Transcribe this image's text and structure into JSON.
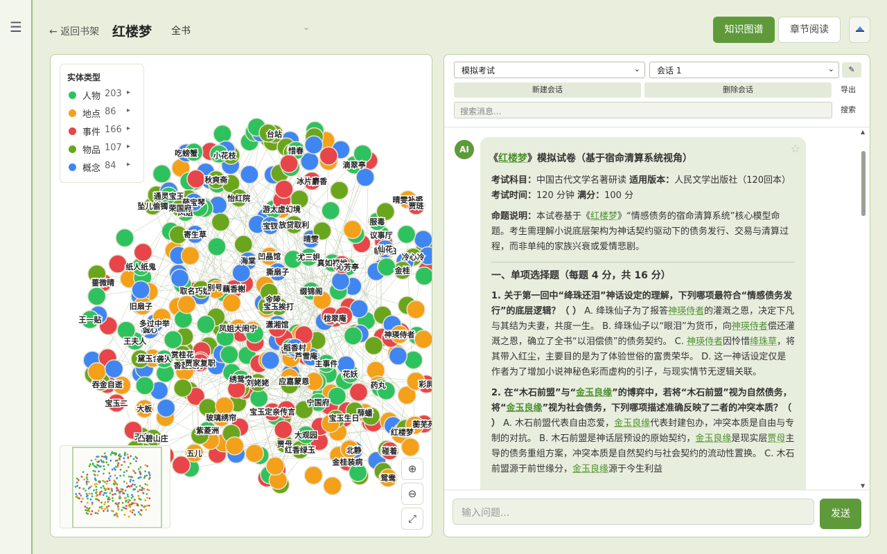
{
  "header": {
    "back_label": "← 返回书架",
    "book_title": "红楼梦",
    "scope_value": "全书",
    "kg_button": "知识图谱",
    "read_button": "章节阅读"
  },
  "legend": {
    "title": "实体类型",
    "items": [
      {
        "label": "人物",
        "count": "203",
        "color": "#2ec25f"
      },
      {
        "label": "地点",
        "count": "86",
        "color": "#f4a018"
      },
      {
        "label": "事件",
        "count": "166",
        "color": "#e8454b"
      },
      {
        "label": "物品",
        "count": "107",
        "color": "#6aa61d"
      },
      {
        "label": "概念",
        "count": "84",
        "color": "#3f86f2"
      }
    ]
  },
  "graph": {
    "labels": [
      "王夫人",
      "金桂装病",
      "香菱受打",
      "天齐",
      "宝玉二",
      "凤姐",
      "吞金自逝",
      "尤三姐",
      "贾母",
      "冷心冷",
      "蔷微晴",
      "小花枝",
      "诚心",
      "凤姐大闹宁",
      "议事厅",
      "薛蟠",
      "晴雯补裘",
      "坠儿偷镯",
      "旧扇子",
      "玻璃绣帘",
      "取名巧姐",
      "吃螃蟹",
      "别号",
      "绣鸳鸯",
      "赏桂花",
      "药丸",
      "撕扇子",
      "冰片麝香",
      "寄生草",
      "纸人纸鬼",
      "宝玉生日",
      "红香绿玉",
      "黛玉含酸",
      "应嘉蒙恩",
      "临安伯",
      "台站",
      "放贷取利",
      "红楼梦",
      "游太虚幻境",
      "真如福地",
      "多过中举",
      "金陵",
      "海棠",
      "大板",
      "香菱",
      "彩屏",
      "贾家复职",
      "五儿",
      "宝玉定亲传言",
      "碰着",
      "服毒",
      "王一贴",
      "花妖",
      "仙花",
      "宝钗",
      "袭人",
      "晴雯",
      "贾琏",
      "惜春",
      "鸳鸯",
      "北静",
      "金桂",
      "主事件",
      "神瑛侍者",
      "宝玉挨打",
      "通灵宝玉",
      "薛宝琴",
      "刘姥姥",
      "大观园",
      "荣国府",
      "宁国府",
      "潇湘馆",
      "怡红院",
      "秋爽斋",
      "稻香村",
      "蘅芜苑",
      "栊翠庵",
      "紫菱洲",
      "芦雪庵",
      "凹晶馆",
      "凸碧山庄",
      "沁芳亭",
      "滴翠亭",
      "藕香榭",
      "缀锦阁"
    ]
  },
  "chat": {
    "mode_select": "模拟考试",
    "session_select": "会话 1",
    "new_session": "新建会话",
    "delete_session": "删除会话",
    "export": "导出",
    "search_placeholder": "搜索消息...",
    "search_button": "搜索",
    "avatar": "AI",
    "input_placeholder": "输入问题...",
    "send": "发送",
    "message": {
      "title_prefix": "《",
      "title_link": "红楼梦",
      "title_suffix": "》模拟试卷（基于宿命清算系统视角）",
      "meta_subject_label": "考试科目：",
      "meta_subject": "中国古代文学名著研读",
      "meta_edition_label": "适用版本：",
      "meta_edition": "人民文学出版社（120回本）",
      "meta_time_label": "考试时间：",
      "meta_time": "120 分钟",
      "meta_score_label": "满分：",
      "meta_score": "100 分",
      "note_label": "命题说明：",
      "note_a": "本试卷基于《",
      "note_link": "红楼梦",
      "note_b": "》“情感债务的宿命清算系统”核心模型命题。考生需理解小说底层架构为神话契约驱动下的债务发行、交易与清算过程，而非单纯的家族兴衰或爱情悲剧。",
      "section1": "一、单项选择题（每题 4 分，共 16 分）",
      "q1_stem": "1. 关于第一回中“绛珠还泪”神话设定的理解，下列哪项最符合“情感债务发行”的底层逻辑？（ ）",
      "q1_a1": "A. 绛珠仙子为了报答",
      "q1_link1": "神瑛侍者",
      "q1_a2": "的灌溉之恩，决定下凡与其结为夫妻，共度一生。 B. 绛珠仙子以“眼泪”为货币，向",
      "q1_link2": "神瑛侍者",
      "q1_b2": "偿还灌溉之恩，确立了全书“以泪偿债”的债务契约。 C.",
      "q1_link3": "神瑛侍者",
      "q1_c1": "因怜惜",
      "q1_link4": "绛珠草",
      "q1_c2": "，将其带入红尘，主要目的是为了体验世俗的富贵荣华。 D. 这一神话设定仅是作者为了增加小说神秘色彩而虚构的引子，与现实情节无逻辑关联。",
      "q2_stem_a": "2. 在“木石前盟”与“",
      "q2_link1": "金玉良缘",
      "q2_stem_b": "”的博弈中，若将“木石前盟”视为自然债务，将“",
      "q2_link2": "金玉良缘",
      "q2_stem_c": "”视为社会债务，下列哪项描述准确反映了二者的冲突本质？（ ）",
      "q2_a1": "A. 木石前盟代表自由恋爱，",
      "q2_link3": "金玉良缘",
      "q2_a2": "代表封建包办，冲突本质是自由与专制的对抗。 B. 木石前盟是神话层预设的原始契约，",
      "q2_link4": "金玉良缘",
      "q2_b1": "是现实层",
      "q2_link5": "贾母",
      "q2_b2": "主导的债务重组方案，冲突本质是自然契约与社会契约的流动性置换。 C. 木石前盟源于前世缘分，",
      "q2_link6": "金玉良缘",
      "q2_c1": "源于今生利益"
    }
  }
}
